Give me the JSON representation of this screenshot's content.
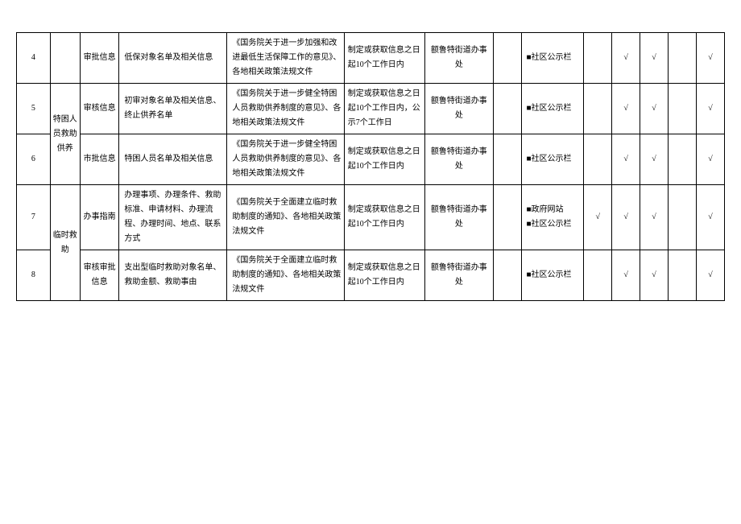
{
  "rows": [
    {
      "num": "4",
      "cat": "",
      "type": "审批信息",
      "content": "低保对象名单及相关信息",
      "basis": "《国务院关于进一步加强和改进最低生活保障工作的意见》、各地相关政策法规文件",
      "time": "制定或获取信息之日起10个工作日内",
      "dept": "额鲁特街道办事处",
      "c1": "",
      "carrier": "■社区公示栏",
      "t1": "",
      "t2": "√",
      "t3": "√",
      "t4": "",
      "t5": "√"
    },
    {
      "num": "5",
      "cat_rowspan": 2,
      "cat": "特困人员救助供养",
      "type": "审核信息",
      "content": "初审对象名单及相关信息、终止供养名单",
      "basis": "《国务院关于进一步健全特困人员救助供养制度的意见》、各地相关政策法规文件",
      "time": "制定或获取信息之日起10个工作日内，公示7个工作日",
      "dept": "额鲁特街道办事处",
      "c1": "",
      "carrier": "■社区公示栏",
      "t1": "",
      "t2": "√",
      "t3": "√",
      "t4": "",
      "t5": "√"
    },
    {
      "num": "6",
      "type": "市批信息",
      "content": "特困人员名单及相关信息",
      "basis": "《国务院关于进一步健全特困人员救助供养制度的意见》、各地相关政策法规文件",
      "time": "制定或获取信息之日起10个工作日内",
      "dept": "额鲁特街道办事处",
      "c1": "",
      "carrier": "■社区公示栏",
      "t1": "",
      "t2": "√",
      "t3": "√",
      "t4": "",
      "t5": "√"
    },
    {
      "num": "7",
      "cat_rowspan": 2,
      "cat": "临时救助",
      "type": "办事指南",
      "content": "办理事项、办理条件、救助标准、申请材料、办理流程、办理时间、地点、联系方式",
      "basis": "《国务院关于全面建立临时救助制度的通知》、各地相关政策法规文件",
      "time": "制定或获取信息之日起10个工作日内",
      "dept": "额鲁特街道办事处",
      "c1": "",
      "carrier": "■政府网站\n■社区公示栏",
      "t1": "√",
      "t2": "√",
      "t3": "√",
      "t4": "",
      "t5": "√"
    },
    {
      "num": "8",
      "type": "审核审批信息",
      "content": "支出型临时救助对象名单、救助金额、救助事由",
      "basis": "《国务院关于全面建立临时救助制度的通知》、各地相关政策法规文件",
      "time": "制定或获取信息之日起10个工作日内",
      "dept": "额鲁特街道办事处",
      "c1": "",
      "carrier": "■社区公示栏",
      "t1": "",
      "t2": "√",
      "t3": "√",
      "t4": "",
      "t5": "√"
    }
  ]
}
